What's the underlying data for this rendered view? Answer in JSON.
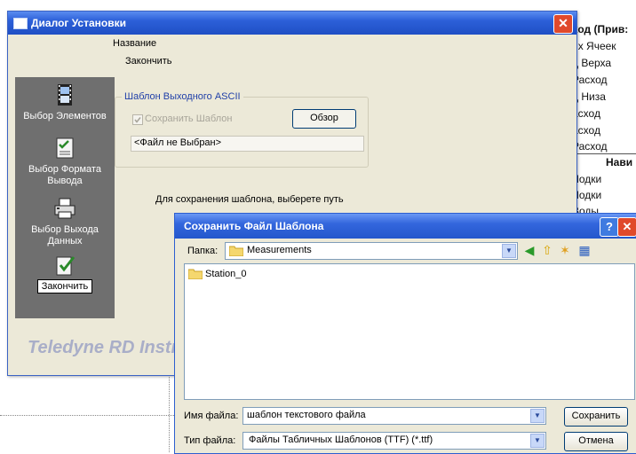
{
  "background_doc": {
    "lines": [
      "ход (Прив:",
      "их Ячеек",
      "д Верха",
      "Расход",
      "д Низа",
      "асход",
      "асход",
      "Расход",
      "Нави",
      "Лодки",
      "Лодки",
      "Воды"
    ]
  },
  "setup_dialog": {
    "title": "Диалог Установки",
    "header_name": "Название",
    "header_finish": "Закончить",
    "sidebar": [
      {
        "label": "Выбор Элементов",
        "icon": "film-icon"
      },
      {
        "label": "Выбор Формата Вывода",
        "icon": "checklist-icon"
      },
      {
        "label": "Выбор Выхода Данных",
        "icon": "printer-icon"
      },
      {
        "label": "Закончить",
        "icon": "finish-icon",
        "active": true
      }
    ],
    "ascii_group": {
      "legend": "Шаблон Выходного ASCII",
      "save_template_label": "Сохранить Шаблон",
      "save_template_checked": true,
      "browse_label": "Обзор",
      "file_value": "<Файл не Выбран>"
    },
    "hint": "Для сохранения шаблона, выберете путь",
    "brand": "Teledyne RD Instrum"
  },
  "save_dialog": {
    "title": "Сохранить Файл Шаблона",
    "help_label": "?",
    "lookin_label": "Папка:",
    "lookin_value": "Measurements",
    "files": [
      {
        "name": "Station_0",
        "type": "folder"
      }
    ],
    "filename_label": "Имя файла:",
    "filename_value": "шаблон текстового файла",
    "filetype_label": "Тип файла:",
    "filetype_value": "Файлы Табличных Шаблонов (TTF) (*.ttf)",
    "save_label": "Сохранить",
    "cancel_label": "Отмена"
  },
  "colors": {
    "titlebar": "#2c5fd8",
    "dialog_bg": "#ece9d8",
    "sidebar_bg": "#6f6f6f",
    "close_red": "#e0492b"
  }
}
